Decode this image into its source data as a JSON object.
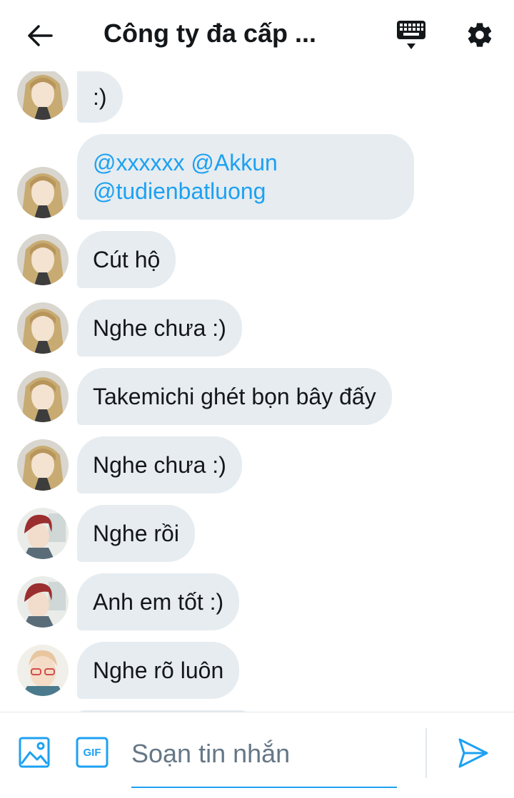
{
  "header": {
    "title": "Công ty đa cấp ...",
    "back_icon": "back-arrow-icon",
    "keyboard_icon": "keyboard-icon",
    "settings_icon": "gear-icon"
  },
  "messages": [
    {
      "sender": "user-blonde",
      "text": ":)"
    },
    {
      "sender": "user-blonde",
      "mentions": [
        "@xxxxxx",
        "@Akkun",
        "@tudienbatluong"
      ]
    },
    {
      "sender": "user-blonde",
      "text": "Cút hộ"
    },
    {
      "sender": "user-blonde",
      "text": "Nghe chưa :)"
    },
    {
      "sender": "user-blonde",
      "text": "Takemichi ghét bọn bây đấy"
    },
    {
      "sender": "user-blonde",
      "text": "Nghe chưa :)"
    },
    {
      "sender": "user-redhair",
      "text": "Nghe rồi"
    },
    {
      "sender": "user-redhair",
      "text": "Anh em tốt :)"
    },
    {
      "sender": "user-glasses",
      "text": "Nghe rõ luôn"
    }
  ],
  "composer": {
    "placeholder": "Soạn tin nhắn",
    "gif_label": "GIF",
    "image_icon": "image-icon",
    "send_icon": "send-icon"
  },
  "colors": {
    "accent": "#1da1f2",
    "bubble": "#e6ecf0",
    "text": "#14171a",
    "placeholder": "#657786"
  }
}
